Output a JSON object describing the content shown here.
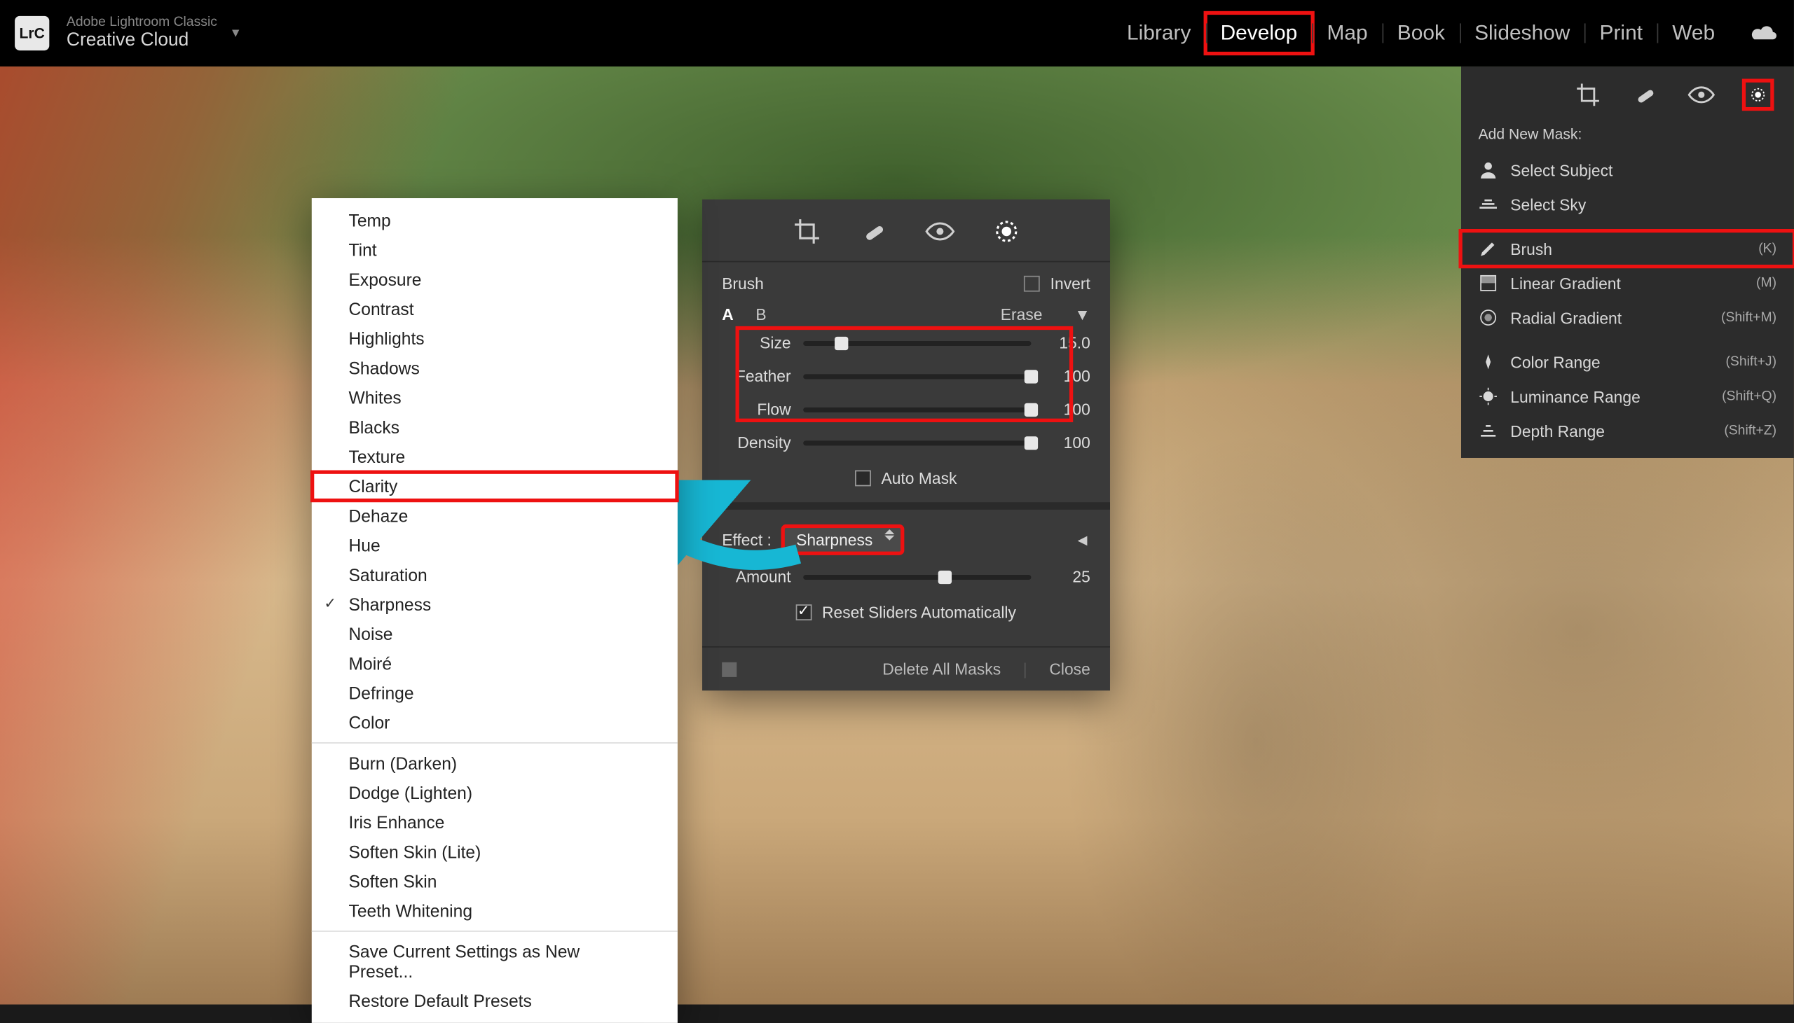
{
  "brand": {
    "line1": "Adobe Lightroom Classic",
    "line2": "Creative Cloud",
    "logo": "LrC"
  },
  "modules": [
    "Library",
    "Develop",
    "Map",
    "Book",
    "Slideshow",
    "Print",
    "Web"
  ],
  "active_module_index": 1,
  "right_panel": {
    "label": "Add New Mask:",
    "groups": [
      [
        {
          "name": "Select Subject",
          "icon": "person-icon",
          "shortcut": ""
        },
        {
          "name": "Select Sky",
          "icon": "sky-icon",
          "shortcut": ""
        }
      ],
      [
        {
          "name": "Brush",
          "icon": "brush-icon",
          "shortcut": "(K)",
          "highlight": true
        },
        {
          "name": "Linear Gradient",
          "icon": "linear-icon",
          "shortcut": "(M)"
        },
        {
          "name": "Radial Gradient",
          "icon": "radial-icon",
          "shortcut": "(Shift+M)"
        }
      ],
      [
        {
          "name": "Color Range",
          "icon": "color-icon",
          "shortcut": "(Shift+J)"
        },
        {
          "name": "Luminance Range",
          "icon": "lum-icon",
          "shortcut": "(Shift+Q)"
        },
        {
          "name": "Depth Range",
          "icon": "depth-icon",
          "shortcut": "(Shift+Z)"
        }
      ]
    ]
  },
  "effects_menu": {
    "sections": [
      [
        "Temp",
        "Tint",
        "Exposure",
        "Contrast",
        "Highlights",
        "Shadows",
        "Whites",
        "Blacks",
        "Texture",
        "Clarity",
        "Dehaze",
        "Hue",
        "Saturation",
        "Sharpness",
        "Noise",
        "Moiré",
        "Defringe",
        "Color"
      ],
      [
        "Burn (Darken)",
        "Dodge (Lighten)",
        "Iris Enhance",
        "Soften Skin (Lite)",
        "Soften Skin",
        "Teeth Whitening"
      ],
      [
        "Save Current Settings as New Preset...",
        "Restore Default Presets"
      ]
    ],
    "checked": "Sharpness",
    "highlighted": "Clarity"
  },
  "brush_panel": {
    "title": "Brush",
    "invert_label": "Invert",
    "ab": {
      "a": "A",
      "b": "B",
      "erase": "Erase"
    },
    "sliders": [
      {
        "label": "Size",
        "value": 15.0,
        "display": "15.0",
        "pct": 17
      },
      {
        "label": "Feather",
        "value": 100,
        "display": "100",
        "pct": 100
      },
      {
        "label": "Flow",
        "value": 100,
        "display": "100",
        "pct": 100
      },
      {
        "label": "Density",
        "value": 100,
        "display": "100",
        "pct": 100
      }
    ],
    "auto_mask": {
      "label": "Auto Mask",
      "checked": false
    },
    "effect_label": "Effect :",
    "effect_value": "Sharpness",
    "amount": {
      "label": "Amount",
      "value": 25,
      "pct": 62
    },
    "reset": {
      "label": "Reset Sliders Automatically",
      "checked": true
    },
    "footer": {
      "delete": "Delete All Masks",
      "close": "Close"
    }
  }
}
